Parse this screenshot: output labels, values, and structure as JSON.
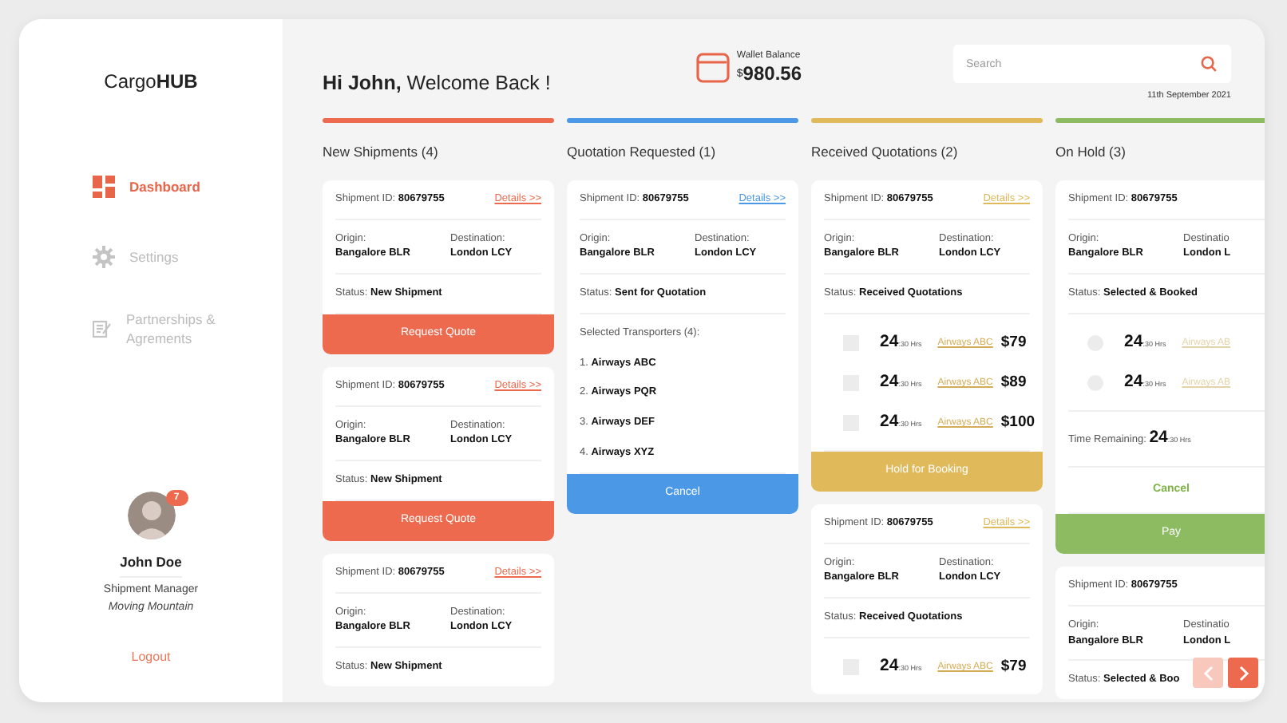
{
  "sidebar": {
    "logo": "Cargo**HUB**",
    "nav": [
      {
        "kind": "dashboard",
        "label": "Dashboard",
        "selected": true
      },
      {
        "kind": "settings",
        "label": "Settings",
        "selected": false
      },
      {
        "kind": "partnerships",
        "label": "Partnerships & Agrements",
        "selected": false
      }
    ],
    "user": {
      "badge": "7",
      "name": "John Doe",
      "role": "Shipment Manager",
      "company": "Moving Mountain"
    },
    "logout": "Logout"
  },
  "header": {
    "greeting": "**Hi John,** Welcome Back !",
    "wallet": {
      "label": "Wallet Balance",
      "currency": "$",
      "amount": "980.56"
    },
    "search": {
      "placeholder": "Search"
    },
    "date": "11th September 2021"
  },
  "columns": [
    {
      "title": "New Shipments (4)",
      "color": "#ee6a4e",
      "cards": [
        {
          "id_label": "Shipment ID:",
          "id": "80679755",
          "details": "Details >>",
          "origin_label": "Origin:",
          "origin": "Bangalore BLR",
          "destination_label": "Destination:",
          "destination": "London LCY",
          "status_label": "Status:",
          "status": "New Shipment",
          "button": {
            "label": "Request Quote"
          }
        },
        {
          "id_label": "Shipment ID:",
          "id": "80679755",
          "details": "Details >>",
          "origin_label": "Origin:",
          "origin": "Bangalore BLR",
          "destination_label": "Destination:",
          "destination": "London LCY",
          "status_label": "Status:",
          "status": "New Shipment",
          "button": {
            "label": "Request Quote"
          }
        },
        {
          "id_label": "Shipment ID:",
          "id": "80679755",
          "details": "Details >>",
          "origin_label": "Origin:",
          "origin": "Bangalore BLR",
          "destination_label": "Destination:",
          "destination": "London LCY",
          "status_label": "Status:",
          "status": "New Shipment"
        }
      ]
    },
    {
      "title": "Quotation Requested (1)",
      "color": "#4a98e6",
      "cards": [
        {
          "id_label": "Shipment ID:",
          "id": "80679755",
          "details": "Details >>",
          "origin_label": "Origin:",
          "origin": "Bangalore BLR",
          "destination_label": "Destination:",
          "destination": "London LCY",
          "status_label": "Status:",
          "status": "Sent for Quotation",
          "transporters": {
            "label": "Selected Transporters (4):",
            "items": [
              {
                "number": "1.",
                "name": "Airways ABC"
              },
              {
                "number": "2.",
                "name": "Airways PQR"
              },
              {
                "number": "3.",
                "name": "Airways DEF"
              },
              {
                "number": "4.",
                "name": "Airways XYZ"
              }
            ]
          },
          "button": {
            "label": "Cancel"
          }
        }
      ]
    },
    {
      "title": "Received Quotations (2)",
      "color": "#dfb95a",
      "cards": [
        {
          "id_label": "Shipment ID:",
          "id": "80679755",
          "details": "Details >>",
          "origin_label": "Origin:",
          "origin": "Bangalore BLR",
          "destination_label": "Destination:",
          "destination": "London LCY",
          "status_label": "Status:",
          "status": "Received Quotations",
          "quotes": [
            {
              "kind": "checkbox",
              "checked": false,
              "hours": "24",
              "unit": ":30 Hrs",
              "airline": "Airways ABC",
              "price": "$79"
            },
            {
              "kind": "checkbox",
              "checked": false,
              "hours": "24",
              "unit": ":30 Hrs",
              "airline": "Airways ABC",
              "price": "$89"
            },
            {
              "kind": "checkbox",
              "checked": false,
              "hours": "24",
              "unit": ":30 Hrs",
              "airline": "Airways ABC",
              "price": "$100"
            }
          ],
          "button": {
            "label": "Hold for Booking"
          }
        },
        {
          "id_label": "Shipment ID:",
          "id": "80679755",
          "details": "Details >>",
          "origin_label": "Origin:",
          "origin": "Bangalore BLR",
          "destination_label": "Destination:",
          "destination": "London LCY",
          "status_label": "Status:",
          "status": "Received Quotations",
          "quotes": [
            {
              "kind": "checkbox",
              "checked": false,
              "hours": "24",
              "unit": ":30 Hrs",
              "airline": "Airways ABC",
              "price": "$79"
            }
          ]
        }
      ]
    },
    {
      "title": "On Hold (3)",
      "color": "#8cbb62",
      "cards": [
        {
          "id_label": "Shipment ID:",
          "id": "80679755",
          "origin_label": "Origin:",
          "origin": "Bangalore BLR",
          "destination_label": "Destinatio",
          "destination": "London L",
          "status_label": "Status:",
          "status": "Selected & Booked",
          "quotes": [
            {
              "kind": "radio",
              "checked": false,
              "hours": "24",
              "unit": ":30 Hrs",
              "airline": "Airways AB"
            },
            {
              "kind": "radio",
              "checked": false,
              "hours": "24",
              "unit": ":30 Hrs",
              "airline": "Airways AB"
            }
          ],
          "time_remaining": {
            "label": "Time Remaining:",
            "hours": "24",
            "unit": ":30 Hrs"
          },
          "cancel_link": "Cancel",
          "button": {
            "label": "Pay"
          }
        },
        {
          "id_label": "Shipment ID:",
          "id": "80679755",
          "origin_label": "Origin:",
          "origin": "Bangalore BLR",
          "destination_label": "Destinatio",
          "destination": "London L",
          "status_label": "Status:",
          "status": "Selected & Boo"
        }
      ]
    }
  ],
  "pager": [
    {
      "kind": "prev",
      "disabled": true
    },
    {
      "kind": "next",
      "disabled": false
    }
  ]
}
